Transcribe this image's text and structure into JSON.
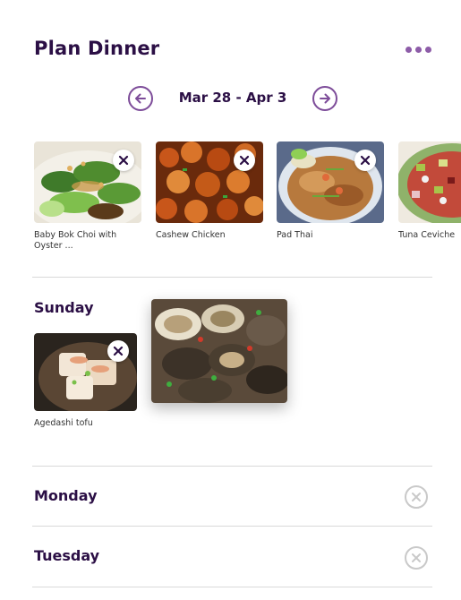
{
  "header": {
    "title": "Plan Dinner",
    "more_icon": "more-horizontal-icon"
  },
  "week_nav": {
    "range": "Mar 28 - Apr 3",
    "prev_icon": "arrow-left-circle-icon",
    "next_icon": "arrow-right-circle-icon"
  },
  "recipes": [
    {
      "name": "Baby Bok Choi with Oyster ..."
    },
    {
      "name": "Cashew Chicken"
    },
    {
      "name": "Pad Thai"
    },
    {
      "name": "Tuna Ceviche"
    }
  ],
  "days": {
    "sunday": {
      "label": "Sunday",
      "meals": [
        {
          "name": "Agedashi tofu"
        }
      ]
    },
    "monday": {
      "label": "Monday"
    },
    "tuesday": {
      "label": "Tuesday"
    }
  },
  "dragging_item": {
    "description_icon": "clams-dish-image"
  },
  "colors": {
    "brand": "#2b0f45",
    "accent": "#8d5ca8",
    "divider": "#d9d9d9",
    "muted": "#c9c9c9"
  }
}
